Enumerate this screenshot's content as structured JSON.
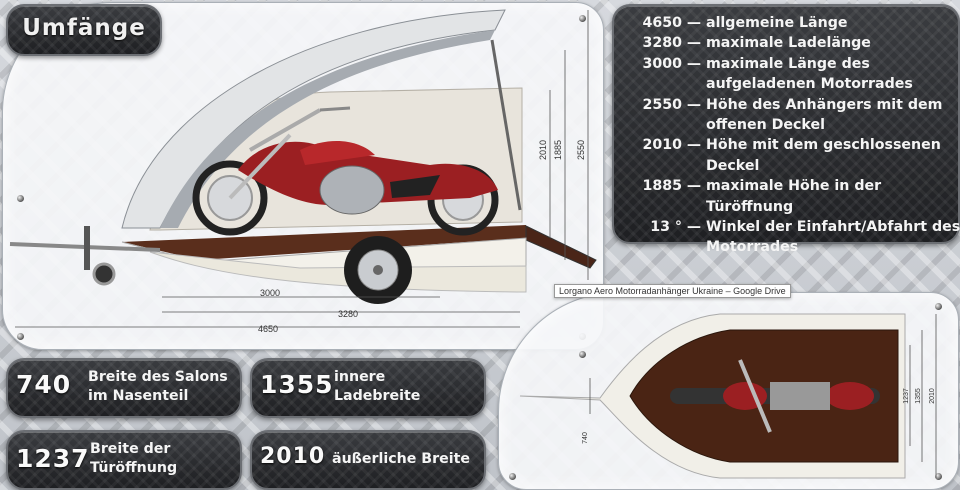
{
  "title": "Umfänge",
  "specs": [
    {
      "value": "4650",
      "dash": "—",
      "desc": "allgemeine Länge"
    },
    {
      "value": "3280",
      "dash": "—",
      "desc": "maximale Ladelänge"
    },
    {
      "value": "3000",
      "dash": "—",
      "desc": "maximale Länge des aufgeladenen Motorrades"
    },
    {
      "value": "2550",
      "dash": "—",
      "desc": "Höhe des Anhängers mit dem offenen Deckel"
    },
    {
      "value": "2010",
      "dash": "—",
      "desc": "Höhe mit dem geschlossenen Deckel"
    },
    {
      "value": "1885",
      "dash": "—",
      "desc": "maximale Höhe in der Türöffnung"
    },
    {
      "value": "13 °",
      "dash": "—",
      "desc": "Winkel der Einfahrt/Abfahrt des Motorrades"
    }
  ],
  "stats": [
    {
      "value": "740",
      "label": "Breite des Salons im Nasenteil"
    },
    {
      "value": "1355",
      "label": "innere Ladebreite"
    },
    {
      "value": "1237",
      "label": "Breite der Türöffnung"
    },
    {
      "value": "2010",
      "label": "äußerliche Breite"
    }
  ],
  "side_dims": {
    "d3000": "3000",
    "d3280": "3280",
    "d4650": "4650",
    "h2010": "2010",
    "h1885": "1885",
    "h2550": "2550"
  },
  "top_dims": {
    "w1237": "1237",
    "w1355": "1355",
    "w2010": "2010",
    "w740": "740"
  },
  "tooltip": "Lorgano Aero Motorradanhänger Ukraine – Google Drive"
}
